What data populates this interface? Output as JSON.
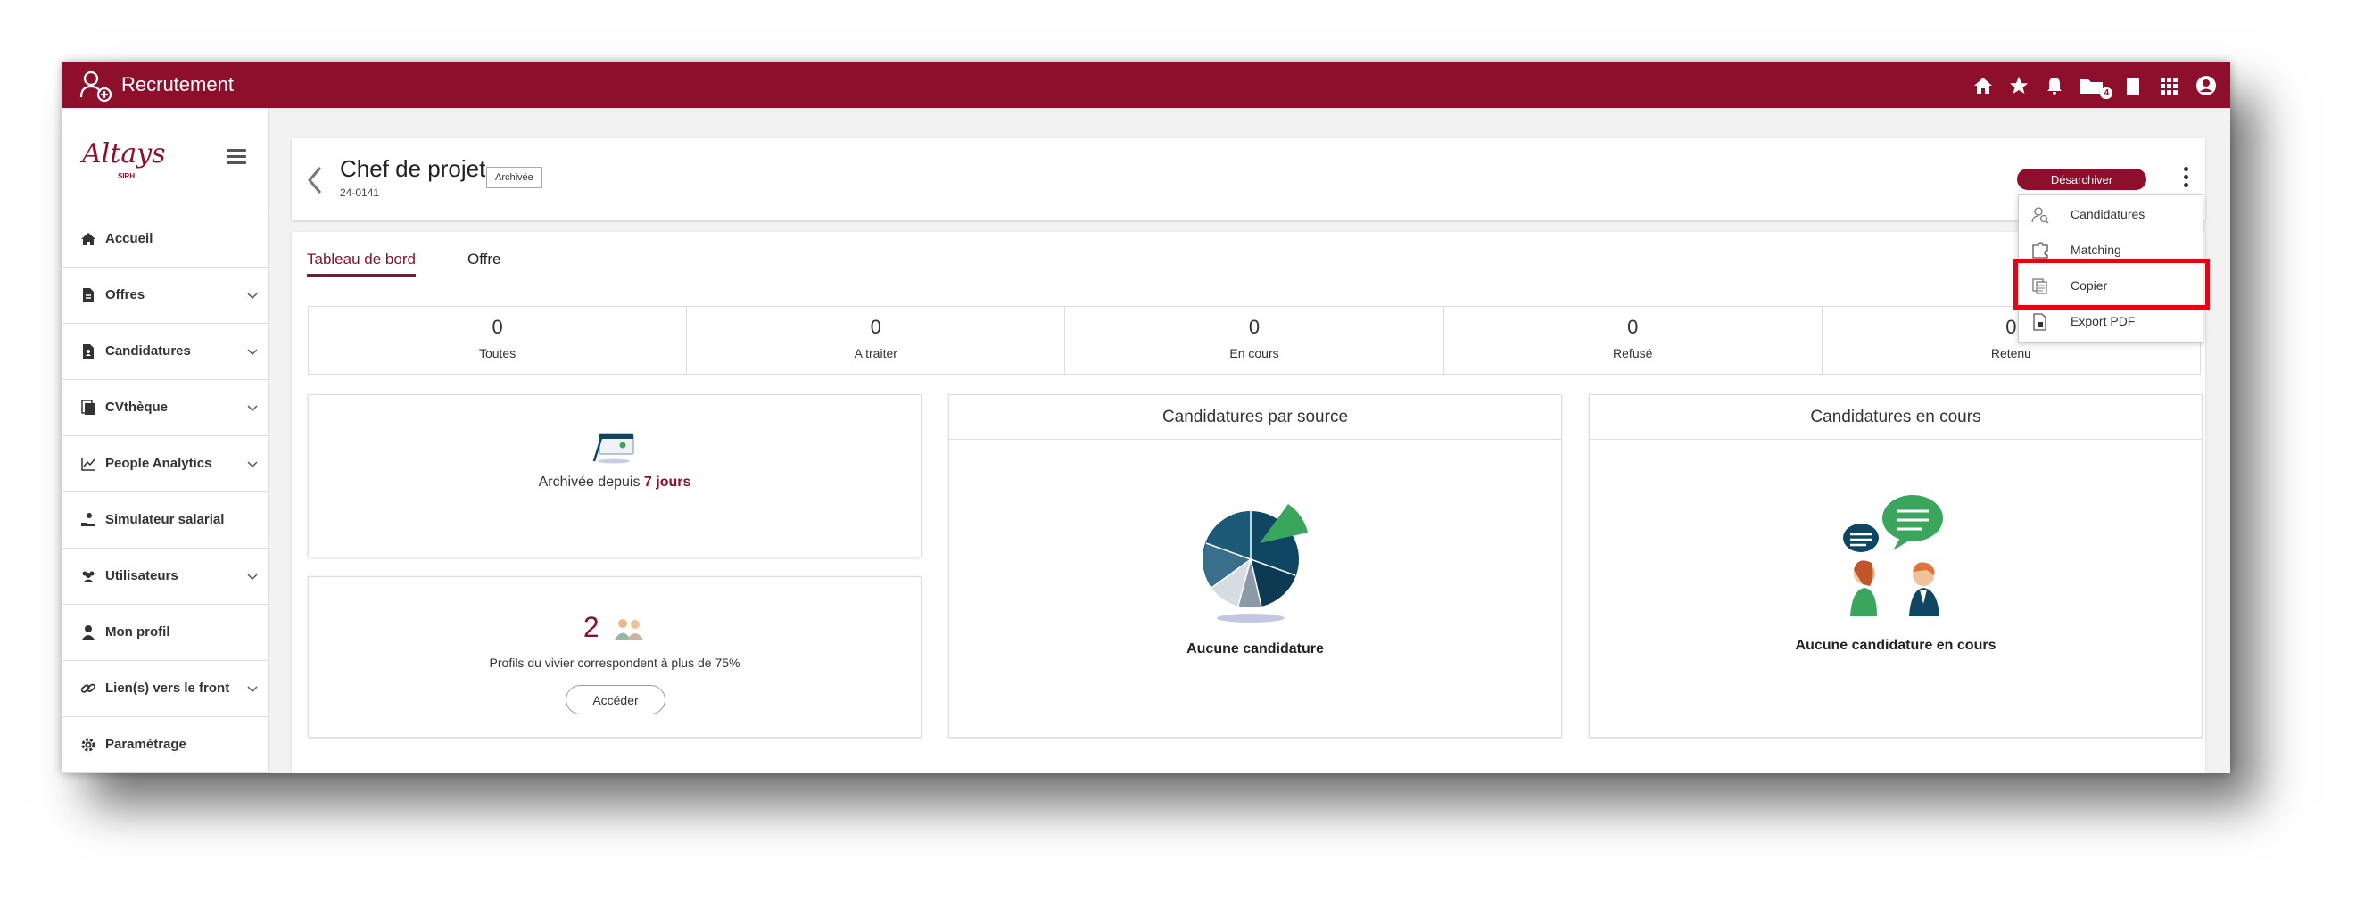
{
  "topbar": {
    "title": "Recrutement",
    "icons": [
      "home-icon",
      "star-icon",
      "bell-icon",
      "folder-icon",
      "book-icon",
      "apps-grid-icon",
      "user-account-icon"
    ],
    "folder_badge": "4",
    "color": "#8e0f2c"
  },
  "sidebar": {
    "brand": "Altays",
    "brand_sub": "SIRH",
    "items": [
      {
        "label": "Accueil",
        "icon": "home-icon",
        "expandable": false
      },
      {
        "label": "Offres",
        "icon": "document-icon",
        "expandable": true
      },
      {
        "label": "Candidatures",
        "icon": "document-user-icon",
        "expandable": true
      },
      {
        "label": "CVthèque",
        "icon": "document-stack-icon",
        "expandable": true
      },
      {
        "label": "People Analytics",
        "icon": "chart-line-icon",
        "expandable": true
      },
      {
        "label": "Simulateur salarial",
        "icon": "hand-coin-icon",
        "expandable": false
      },
      {
        "label": "Utilisateurs",
        "icon": "users-icon",
        "expandable": true
      },
      {
        "label": "Mon profil",
        "icon": "person-icon",
        "expandable": false
      },
      {
        "label": "Lien(s) vers le front",
        "icon": "link-icon",
        "expandable": true
      },
      {
        "label": "Paramétrage",
        "icon": "gear-icon",
        "expandable": false
      }
    ]
  },
  "header": {
    "title": "Chef de projet",
    "reference": "24-0141",
    "status": "Archivée",
    "unarchive_label": "Désarchiver"
  },
  "tabs": [
    {
      "label": "Tableau de bord",
      "active": true
    },
    {
      "label": "Offre",
      "active": false
    }
  ],
  "stats": [
    {
      "value": "0",
      "label": "Toutes"
    },
    {
      "value": "0",
      "label": "A traiter"
    },
    {
      "value": "0",
      "label": "En cours"
    },
    {
      "value": "0",
      "label": "Refusé"
    },
    {
      "value": "0",
      "label": "Retenu"
    }
  ],
  "archived_card": {
    "prefix": "Archivée depuis",
    "duration": "7 jours"
  },
  "pool_card": {
    "count": "2",
    "text": "Profils du vivier correspondent à plus de 75%",
    "button": "Accéder"
  },
  "source_card": {
    "title": "Candidatures par source",
    "empty_text": "Aucune candidature"
  },
  "progress_card": {
    "title": "Candidatures en cours",
    "empty_text": "Aucune candidature en cours"
  },
  "dropdown": {
    "items": [
      {
        "label": "Candidatures",
        "icon": "user-search-icon"
      },
      {
        "label": "Matching",
        "icon": "puzzle-icon"
      },
      {
        "label": "Copier",
        "icon": "copy-icon",
        "highlighted": true
      },
      {
        "label": "Export PDF",
        "icon": "pdf-export-icon"
      }
    ]
  },
  "colors": {
    "brand": "#8e0f2c",
    "highlight": "#e30613",
    "accent_green": "#3aa55c",
    "accent_navy": "#0f4763"
  }
}
